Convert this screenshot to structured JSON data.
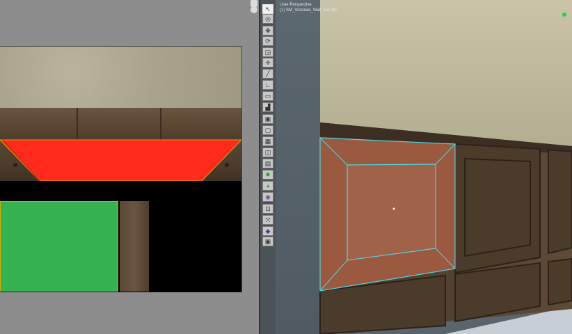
{
  "viewport": {
    "perspective_label": "User Perspective",
    "object_label": "(1) SM_Victorian_Wall_1x1 001"
  },
  "tools": [
    {
      "icon": "select-arrow-icon",
      "glyph": "↖",
      "active": true
    },
    {
      "icon": "select-circle-icon",
      "glyph": "◎"
    },
    {
      "icon": "move-icon",
      "glyph": "✥"
    },
    {
      "icon": "rotate-icon",
      "glyph": "⟳"
    },
    {
      "icon": "scale-icon",
      "glyph": "◲"
    },
    {
      "icon": "gizmo-icon",
      "glyph": "✛"
    },
    {
      "icon": "line-tool-icon",
      "glyph": "╱"
    },
    {
      "icon": "corner-tool-icon",
      "glyph": "∟"
    },
    {
      "icon": "ruler-icon",
      "glyph": "▭"
    },
    {
      "icon": "stair-icon",
      "glyph": "▟"
    },
    {
      "icon": "box-icon",
      "glyph": "▣"
    },
    {
      "icon": "box-outline-icon",
      "glyph": "▢"
    },
    {
      "icon": "cube-icon",
      "glyph": "▦"
    },
    {
      "icon": "cube-open-icon",
      "glyph": "◫"
    },
    {
      "icon": "grid-icon",
      "glyph": "▤"
    },
    {
      "icon": "star-icon",
      "glyph": "✸"
    },
    {
      "icon": "paint-icon",
      "glyph": "◕"
    },
    {
      "icon": "material-icon",
      "glyph": "◉"
    },
    {
      "icon": "frame-icon",
      "glyph": "⊡"
    },
    {
      "icon": "arrows-icon",
      "glyph": "⤧"
    },
    {
      "icon": "purple-shape-icon",
      "glyph": "◆"
    },
    {
      "icon": "box-small-icon",
      "glyph": "▣"
    }
  ],
  "colors": {
    "selection_outline": "#4ed6e0",
    "uv_face_selected": "#ff2a1a",
    "uv_face_green": "#36b24f",
    "uv_border": "#d7a600",
    "status_dot": "#2ecc40"
  }
}
